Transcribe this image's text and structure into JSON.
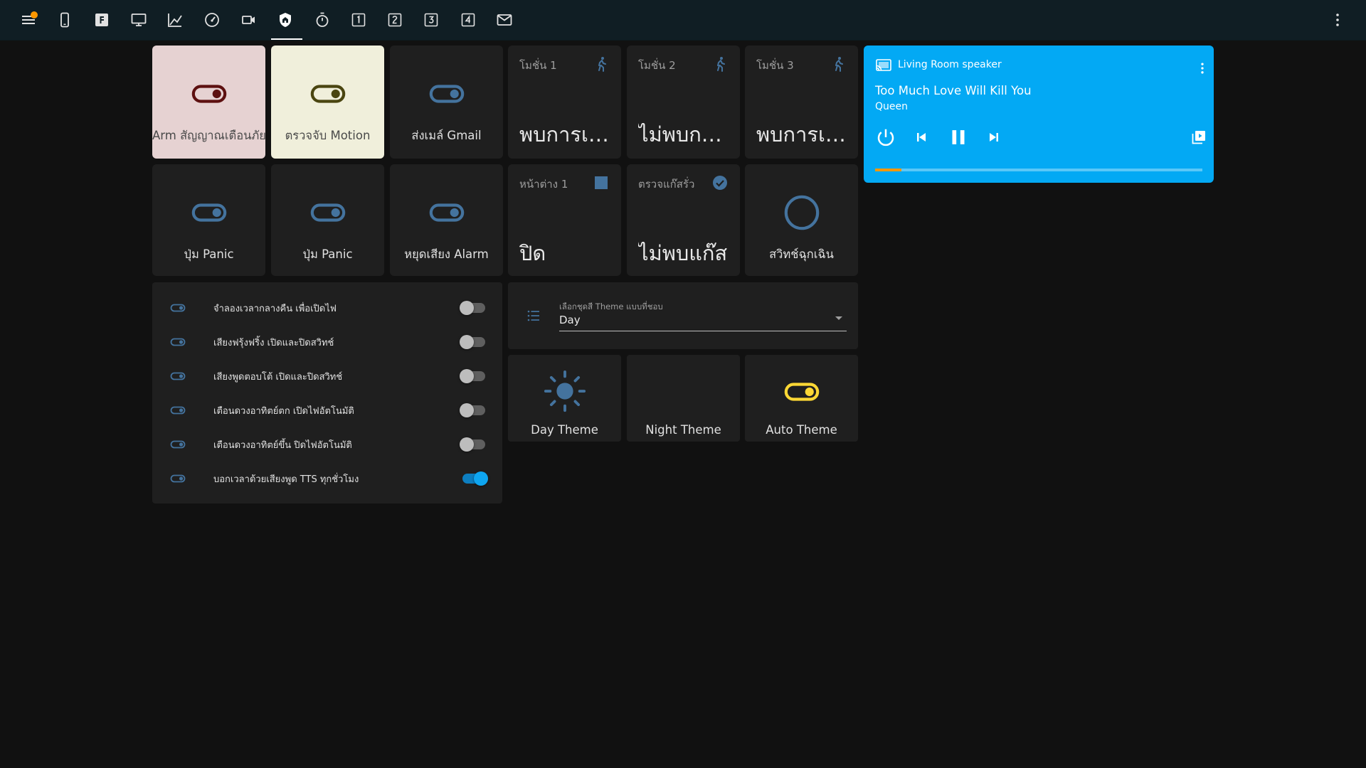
{
  "toolbar": {
    "icons": [
      "menu-icon",
      "cellphone-icon",
      "f-box-icon",
      "monitor-icon",
      "chart-line-icon",
      "speedometer-icon",
      "video-camera-icon",
      "shield-home-icon",
      "timer-icon",
      "numeric-1-box-icon",
      "numeric-2-box-icon",
      "numeric-3-box-icon",
      "numeric-4-box-icon",
      "email-icon",
      "more-vert-icon"
    ],
    "active_tab": "shield-home-icon",
    "notification_color": "#ff9800"
  },
  "buttons_row1": [
    {
      "label": "Arm สัญญาณเตือนภัย",
      "icon": "toggle-on-icon",
      "state": "on",
      "color": "#5d1010"
    },
    {
      "label": "ตรวจจับ Motion",
      "icon": "toggle-on-icon",
      "state": "on",
      "color": "#4a4510"
    },
    {
      "label": "ส่งเมล์ Gmail",
      "icon": "toggle-on-icon",
      "state": "off",
      "color": "#44739e"
    }
  ],
  "motion_sensors": [
    {
      "name": "โมชั่น 1",
      "state": "พบการเค...",
      "icon": "walk-icon"
    },
    {
      "name": "โมชั่น 2",
      "state": "ไม่พบการ...",
      "icon": "walk-icon"
    },
    {
      "name": "โมชั่น 3",
      "state": "พบการเค...",
      "icon": "walk-icon"
    }
  ],
  "buttons_row2": [
    {
      "label": "ปุ่ม Panic",
      "icon": "toggle-on-icon"
    },
    {
      "label": "ปุ่ม Panic",
      "icon": "toggle-on-icon"
    },
    {
      "label": "หยุดเสียง Alarm",
      "icon": "toggle-on-icon"
    }
  ],
  "window_sensor": {
    "name": "หน้าต่าง 1",
    "state": "ปิด",
    "icon": "square-icon"
  },
  "gas_sensor": {
    "name": "ตรวจแก๊สรั่ว",
    "state": "ไม่พบแก๊ส",
    "icon": "check-circle-icon"
  },
  "emergency_switch": {
    "label": "สวิทช์ฉุกเฉิน",
    "icon": "circle-outline-icon"
  },
  "toggles": [
    {
      "label": "จำลองเวลากลางคืน เพื่อเปิดไฟ",
      "on": false
    },
    {
      "label": "เสียงฟรุ้งฟริ้ง เปิดและปิดสวิทช์",
      "on": false
    },
    {
      "label": "เสียงพูดตอบโต้ เปิดและปิดสวิทช์",
      "on": false
    },
    {
      "label": "เตือนดวงอาทิตย์ตก เปิดไฟอัตโนมัติ",
      "on": false
    },
    {
      "label": "เตือนดวงอาทิตย์ขึ้น ปิดไฟอัตโนมัติ",
      "on": false
    },
    {
      "label": "บอกเวลาด้วยเสียงพูด TTS ทุกชั่วโมง",
      "on": true
    }
  ],
  "theme_select": {
    "label": "เลือกชุดสี Theme แบบที่ชอบ",
    "value": "Day",
    "icon": "format-list-bulleted-icon"
  },
  "theme_buttons": [
    {
      "label": "Day Theme",
      "icon": "sun-icon",
      "color": "#44739e"
    },
    {
      "label": "Night Theme",
      "icon": "moon-icon",
      "color": "#44739e"
    },
    {
      "label": "Auto Theme",
      "icon": "toggle-on-icon",
      "color": "#fdd835"
    }
  ],
  "media_player": {
    "source": "Living Room speaker",
    "title": "Too Much Love Will Kill You",
    "artist": "Queen",
    "progress": 0.08,
    "background": "#03a9f4",
    "progress_color": "#ff9800"
  }
}
